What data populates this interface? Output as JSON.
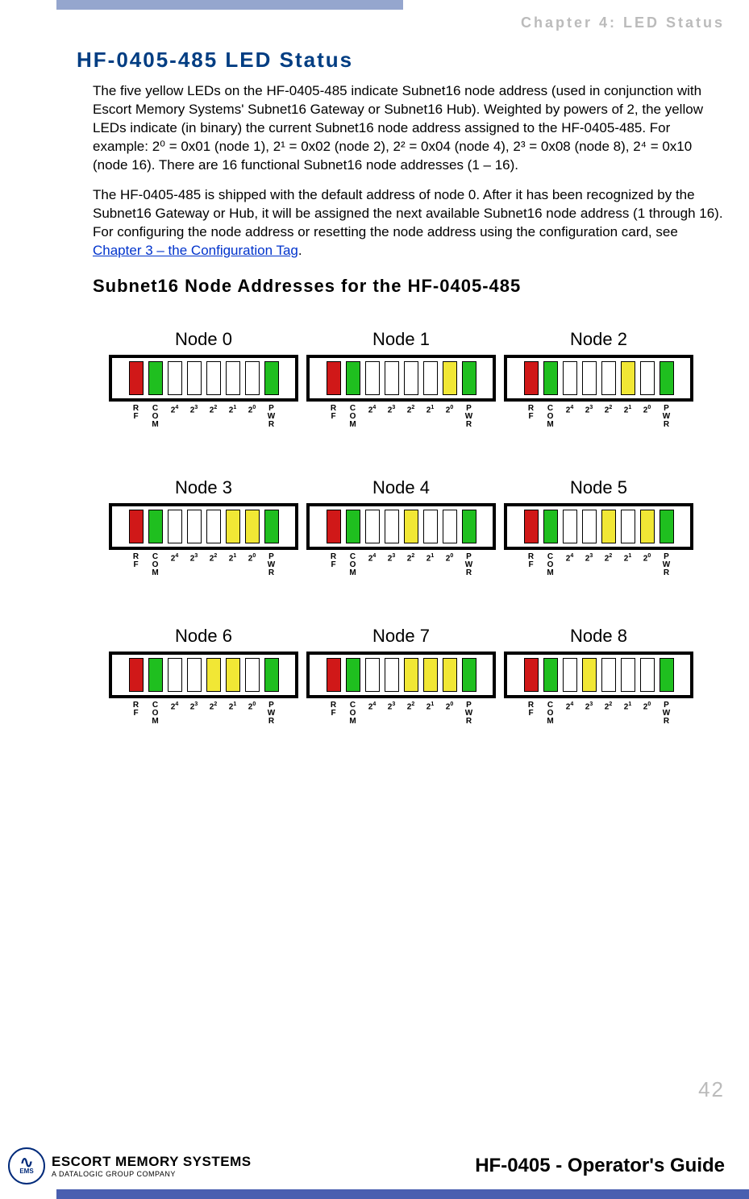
{
  "header": {
    "chapter_label": "Chapter 4: LED Status"
  },
  "section": {
    "title": "HF-0405-485 LED Status",
    "para1": "The five yellow LEDs on the HF-0405-485 indicate Subnet16 node address (used in conjunction with Escort Memory Systems' Subnet16 Gateway or Subnet16 Hub). Weighted by powers of 2, the yellow LEDs indicate (in binary) the current Subnet16 node address assigned to the HF-0405-485. For example: 2⁰ = 0x01 (node 1), 2¹ = 0x02 (node 2), 2² = 0x04 (node 4), 2³ = 0x08 (node 8), 2⁴ = 0x10 (node 16). There are 16 functional Subnet16 node addresses (1 – 16).",
    "para2_a": "The HF-0405-485 is shipped with the default address of node 0. After it has been recognized by the Subnet16 Gateway or Hub, it will be assigned the next available Subnet16 node address (1 through 16). For configuring the node address or resetting the node address using the configuration card, see ",
    "para2_link": "Chapter 3 – the Configuration Tag",
    "para2_b": ".",
    "subtitle": "Subnet16 Node Addresses for the HF-0405-485"
  },
  "led_labels": {
    "rf": "R\nF",
    "com": "C\nO\nM",
    "p4": "2",
    "p4s": "4",
    "p3": "2",
    "p3s": "3",
    "p2": "2",
    "p2s": "2",
    "p1": "2",
    "p1s": "1",
    "p0": "2",
    "p0s": "0",
    "pwr": "P\nW\nR"
  },
  "nodes": [
    {
      "title": "Node 0",
      "leds": [
        "red",
        "green",
        "off",
        "off",
        "off",
        "off",
        "off",
        "green"
      ]
    },
    {
      "title": "Node 1",
      "leds": [
        "red",
        "green",
        "off",
        "off",
        "off",
        "off",
        "yellow",
        "green"
      ]
    },
    {
      "title": "Node 2",
      "leds": [
        "red",
        "green",
        "off",
        "off",
        "off",
        "yellow",
        "off",
        "green"
      ]
    },
    {
      "title": "Node 3",
      "leds": [
        "red",
        "green",
        "off",
        "off",
        "off",
        "yellow",
        "yellow",
        "green"
      ]
    },
    {
      "title": "Node 4",
      "leds": [
        "red",
        "green",
        "off",
        "off",
        "yellow",
        "off",
        "off",
        "green"
      ]
    },
    {
      "title": "Node 5",
      "leds": [
        "red",
        "green",
        "off",
        "off",
        "yellow",
        "off",
        "yellow",
        "green"
      ]
    },
    {
      "title": "Node 6",
      "leds": [
        "red",
        "green",
        "off",
        "off",
        "yellow",
        "yellow",
        "off",
        "green"
      ]
    },
    {
      "title": "Node 7",
      "leds": [
        "red",
        "green",
        "off",
        "off",
        "yellow",
        "yellow",
        "yellow",
        "green"
      ]
    },
    {
      "title": "Node 8",
      "leds": [
        "red",
        "green",
        "off",
        "yellow",
        "off",
        "off",
        "off",
        "green"
      ]
    }
  ],
  "page_number": "42",
  "footer": {
    "logo_line1": "ESCORT MEMORY SYSTEMS",
    "logo_line2": "A DATALOGIC GROUP COMPANY",
    "guide_title": "HF-0405 - Operator's Guide",
    "ems_small": "EMS"
  }
}
